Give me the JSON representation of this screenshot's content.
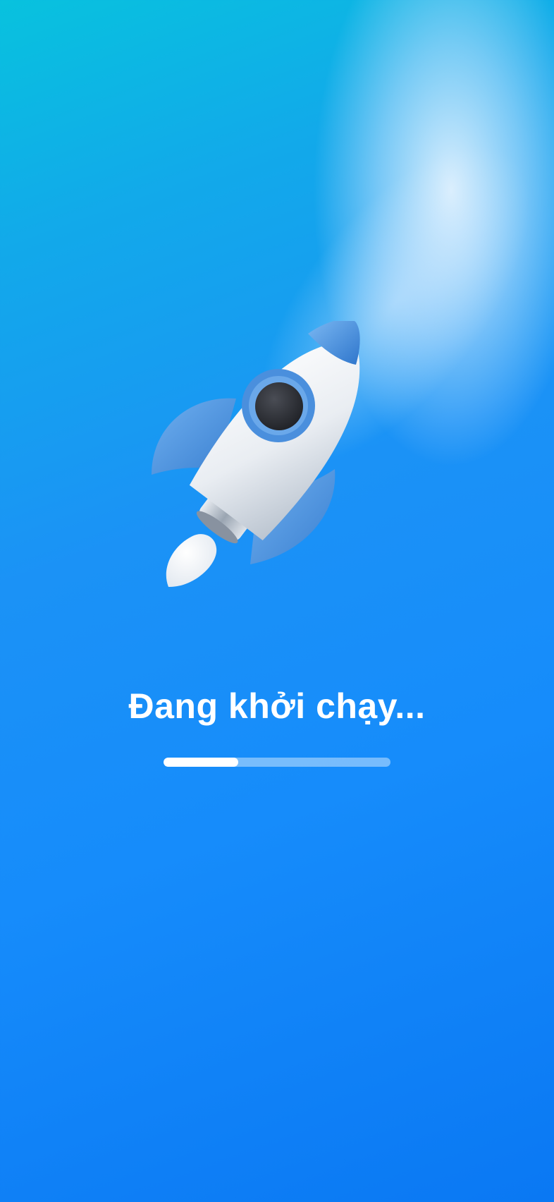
{
  "screen": {
    "status_text": "Đang khởi chạy...",
    "progress": 0.33
  },
  "icons": {
    "hero": "rocket-icon"
  },
  "colors": {
    "background_top": "#08c2de",
    "background_mid": "#1b92f6",
    "background_bottom": "#0a78f3",
    "rocket_body": "#eef1f5",
    "rocket_accent": "#4a8fdd",
    "text": "#ffffff"
  }
}
